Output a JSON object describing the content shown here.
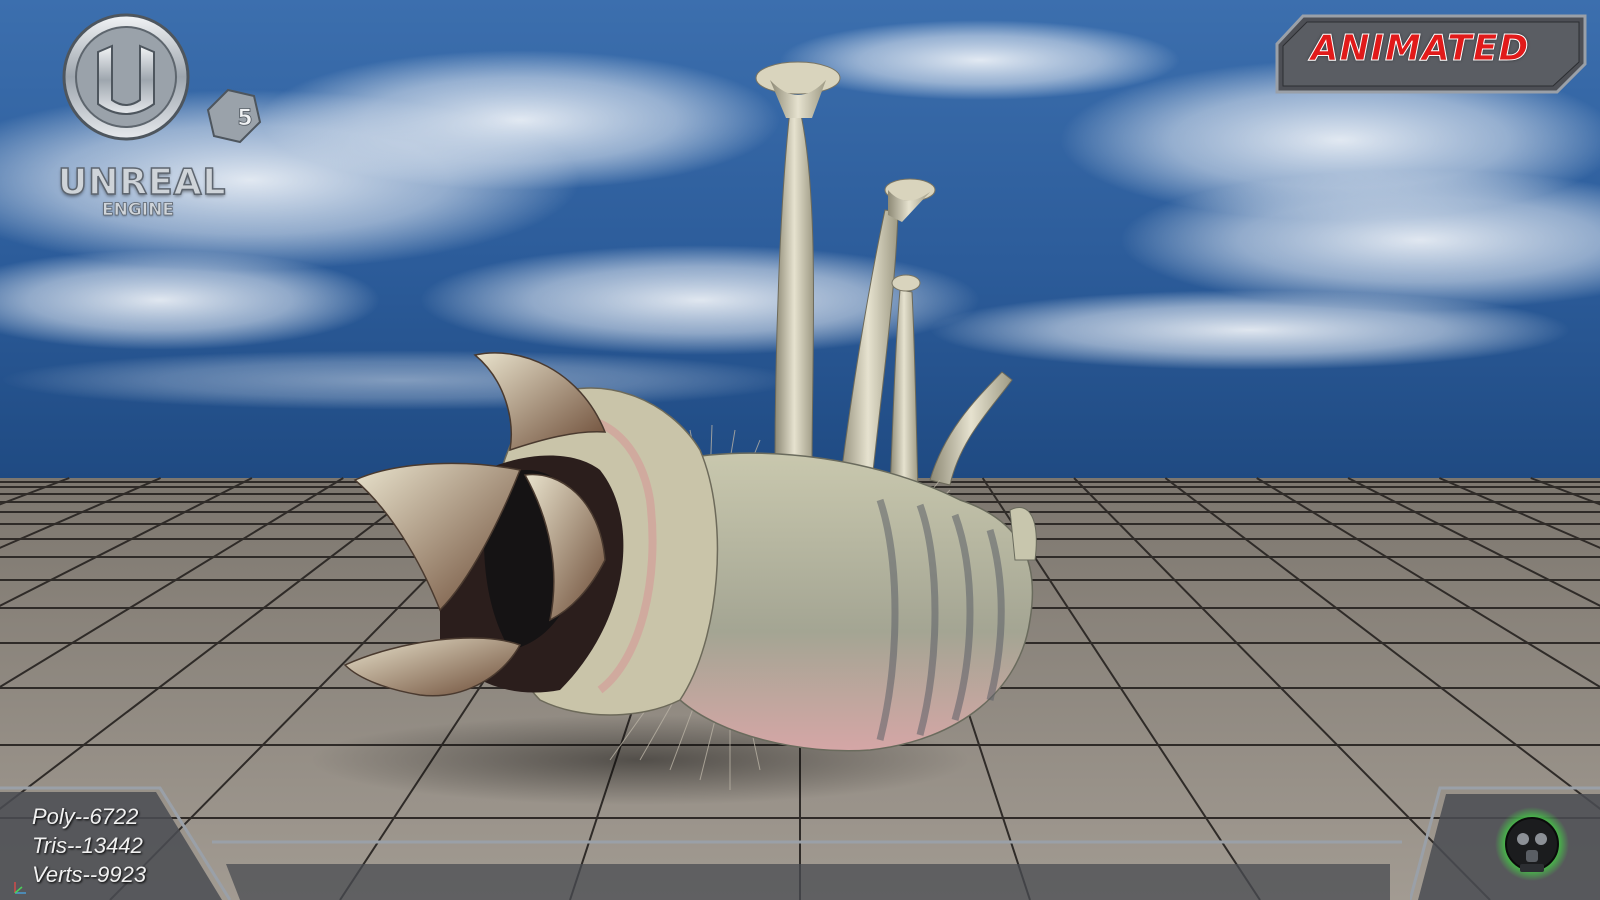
{
  "scene": {
    "sky_color_top": "#2e5a9b",
    "sky_color_horizon": "#1e4c8a",
    "floor_color": "#8a847d",
    "grid_line_color": "#2e2a27"
  },
  "logo": {
    "wordmark": "UNREAL",
    "sub": "ENGINE",
    "version": "5"
  },
  "badge": {
    "label": "ANIMATED",
    "color": "#e11a1a"
  },
  "stats": {
    "poly": "Poly--6722",
    "tris": "Tris--13442",
    "verts": "Verts--9923"
  },
  "icons": {
    "gas_mask": "gas-mask-icon",
    "axis_gizmo": "axis-gizmo-icon"
  }
}
